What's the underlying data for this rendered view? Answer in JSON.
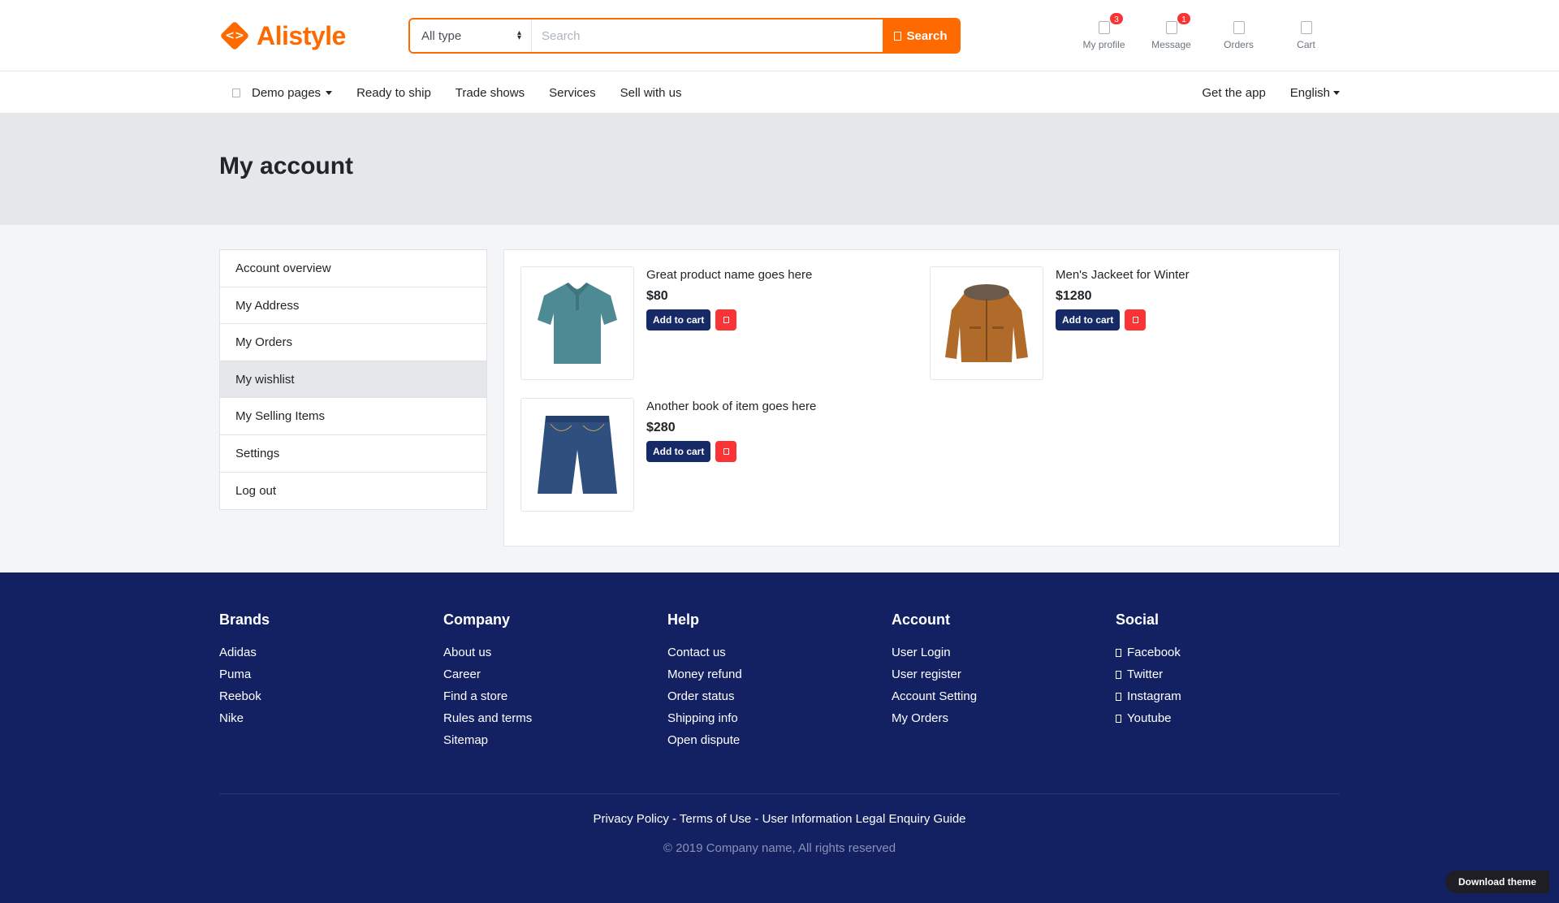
{
  "header": {
    "logo_text": "Alistyle",
    "search": {
      "type_selected": "All type",
      "placeholder": "Search",
      "button_label": "Search"
    },
    "widgets": [
      {
        "label": "My profile",
        "badge": "3"
      },
      {
        "label": "Message",
        "badge": "1"
      },
      {
        "label": "Orders",
        "badge": ""
      },
      {
        "label": "Cart",
        "badge": ""
      }
    ]
  },
  "nav": {
    "items": [
      "Demo pages",
      "Ready to ship",
      "Trade shows",
      "Services",
      "Sell with us"
    ],
    "right": {
      "app": "Get the app",
      "language": "English"
    }
  },
  "page": {
    "title": "My account"
  },
  "sidebar": {
    "items": [
      {
        "label": "Account overview"
      },
      {
        "label": "My Address"
      },
      {
        "label": "My Orders"
      },
      {
        "label": "My wishlist",
        "active": true
      },
      {
        "label": "My Selling Items"
      },
      {
        "label": "Settings"
      },
      {
        "label": "Log out"
      }
    ]
  },
  "wishlist": {
    "add_to_cart_label": "Add to cart",
    "products": [
      {
        "name": "Great product name goes here",
        "price": "$80",
        "image": "teal-polo-shirt"
      },
      {
        "name": "Men's Jackeet for Winter",
        "price": "$1280",
        "image": "brown-winter-jacket"
      },
      {
        "name": "Another book of item goes here",
        "price": "$280",
        "image": "denim-shorts"
      }
    ]
  },
  "footer": {
    "columns": [
      {
        "title": "Brands",
        "links": [
          "Adidas",
          "Puma",
          "Reebok",
          "Nike"
        ]
      },
      {
        "title": "Company",
        "links": [
          "About us",
          "Career",
          "Find a store",
          "Rules and terms",
          "Sitemap"
        ]
      },
      {
        "title": "Help",
        "links": [
          "Contact us",
          "Money refund",
          "Order status",
          "Shipping info",
          "Open dispute"
        ]
      },
      {
        "title": "Account",
        "links": [
          "User Login",
          "User register",
          "Account Setting",
          "My Orders"
        ]
      },
      {
        "title": "Social",
        "links": [
          "Facebook",
          "Twitter",
          "Instagram",
          "Youtube"
        ]
      }
    ],
    "bottom_links": "Privacy Policy - Terms of Use - User Information Legal Enquiry Guide",
    "copyright": "© 2019 Company name, All rights reserved",
    "download_theme": "Download theme"
  },
  "colors": {
    "accent": "#ff6a00",
    "footer_bg": "#132163",
    "cart_button": "#152a66",
    "heart_button": "#fa3434",
    "badge": "#fa3434"
  }
}
